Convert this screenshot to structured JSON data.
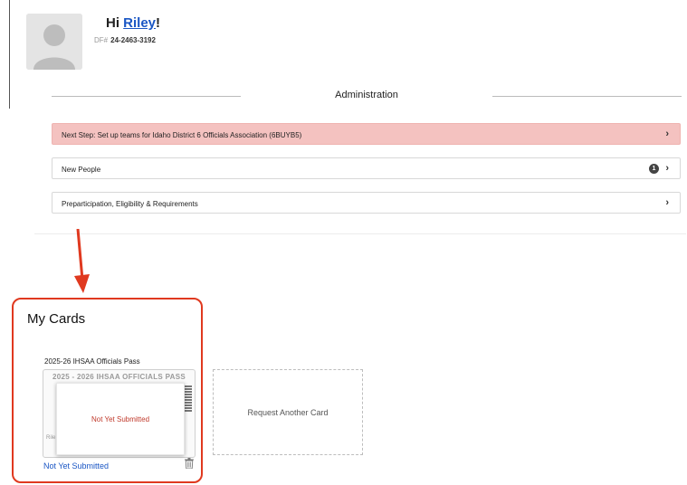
{
  "profile": {
    "greeting_prefix": "Hi ",
    "name": "Riley",
    "greeting_suffix": "!",
    "id_label": "DF#",
    "id_value": "24-2463-3192"
  },
  "administration": {
    "title": "Administration",
    "rows": [
      {
        "label": "Next Step: Set up teams for Idaho District 6 Officials Association (6BUYB5)",
        "alert": true
      },
      {
        "label": "New People",
        "badge": "1"
      },
      {
        "label": "Preparticipation, Eligibility & Requirements"
      }
    ]
  },
  "my_cards": {
    "title": "My Cards",
    "card": {
      "label": "2025-26 IHSAA Officials Pass",
      "image_title": "2025 - 2026 IHSAA OFFICIALS PASS",
      "faint_name": "Rile",
      "overlay_text": "Not Yet Submitted",
      "status_link": "Not Yet Submitted"
    },
    "request_label": "Request Another Card"
  },
  "colors": {
    "link": "#1a56c4",
    "alert_bg": "#f4c2c0",
    "highlight": "#e0391f",
    "status_red": "#c0392b"
  },
  "icons": [
    "avatar-placeholder",
    "chevron-right-icon",
    "trash-icon",
    "red-arrow-annotation"
  ]
}
